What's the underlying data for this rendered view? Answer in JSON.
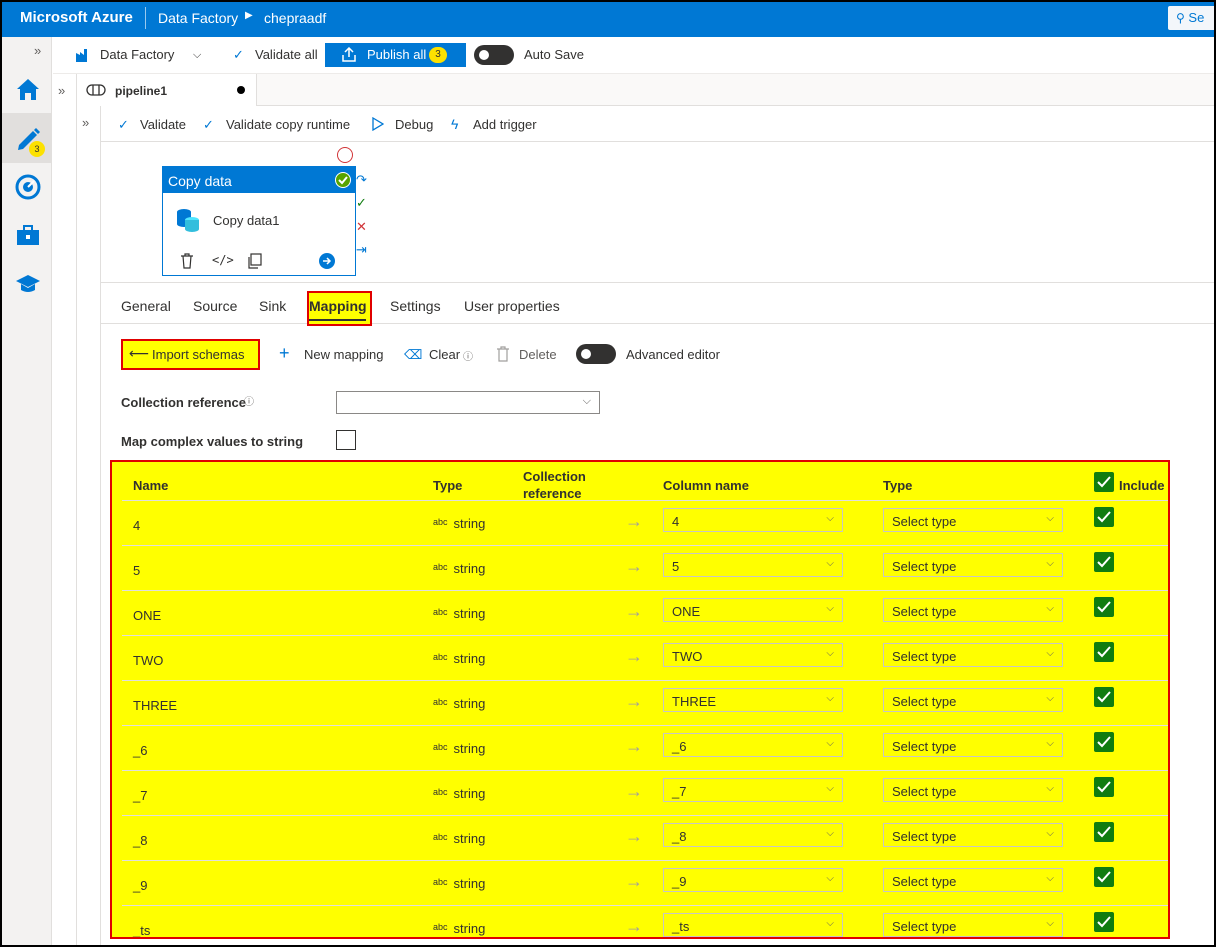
{
  "topbar": {
    "brand": "Microsoft Azure",
    "crumb1": "Data Factory",
    "crumb2": "chepraadf",
    "search": "Se"
  },
  "rail": {
    "author_badge": "3"
  },
  "factorybar": {
    "factory": "Data Factory",
    "validate_all": "Validate all",
    "publish_all": "Publish all",
    "publish_count": "3",
    "auto_save": "Auto Save"
  },
  "pipeline_tab": {
    "name": "pipeline1"
  },
  "pipebar": {
    "validate": "Validate",
    "validate_runtime": "Validate copy runtime",
    "debug": "Debug",
    "add_trigger": "Add trigger"
  },
  "activity": {
    "header": "Copy data",
    "name": "Copy data1"
  },
  "subtabs": [
    "General",
    "Source",
    "Sink",
    "Mapping",
    "Settings",
    "User properties"
  ],
  "mapping_toolbar": {
    "import": "Import schemas",
    "new_mapping": "New mapping",
    "clear": "Clear",
    "delete": "Delete",
    "advanced_editor": "Advanced editor"
  },
  "form": {
    "collection_reference": "Collection reference",
    "map_complex": "Map complex values to string"
  },
  "table": {
    "headers": {
      "name": "Name",
      "type": "Type",
      "collection_ref_1": "Collection",
      "collection_ref_2": "reference",
      "column_name": "Column name",
      "sink_type": "Type",
      "include": "Include"
    },
    "type_prefix": "abc",
    "rows": [
      {
        "name": "4",
        "type": "string",
        "column": "4",
        "sink_type": "Select type"
      },
      {
        "name": "5",
        "type": "string",
        "column": "5",
        "sink_type": "Select type"
      },
      {
        "name": "ONE",
        "type": "string",
        "column": "ONE",
        "sink_type": "Select type"
      },
      {
        "name": "TWO",
        "type": "string",
        "column": "TWO",
        "sink_type": "Select type"
      },
      {
        "name": "THREE",
        "type": "string",
        "column": "THREE",
        "sink_type": "Select type"
      },
      {
        "name": "_6",
        "type": "string",
        "column": "_6",
        "sink_type": "Select type"
      },
      {
        "name": "_7",
        "type": "string",
        "column": "_7",
        "sink_type": "Select type"
      },
      {
        "name": "_8",
        "type": "string",
        "column": "_8",
        "sink_type": "Select type"
      },
      {
        "name": "_9",
        "type": "string",
        "column": "_9",
        "sink_type": "Select type"
      },
      {
        "name": "_ts",
        "type": "string",
        "column": "_ts",
        "sink_type": "Select type"
      }
    ]
  },
  "colors": {
    "azure_blue": "#0078d4",
    "highlight_yellow": "#ffff00",
    "highlight_red": "#e00000",
    "include_green": "#107c10"
  }
}
